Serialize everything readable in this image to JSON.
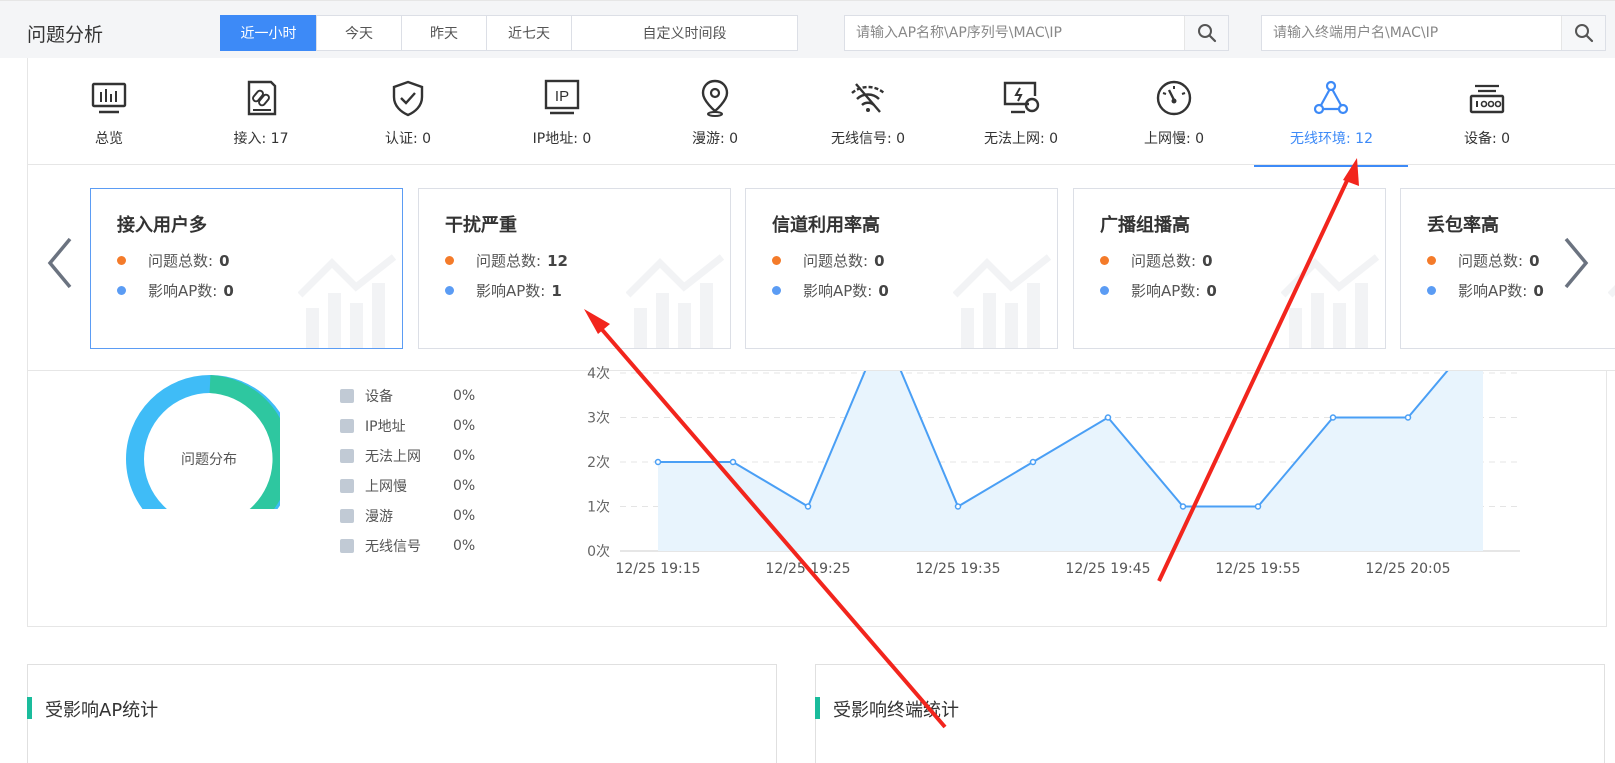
{
  "header": {
    "title": "问题分析",
    "time_tabs": [
      "近一小时",
      "今天",
      "昨天",
      "近七天",
      "自定义时间段"
    ],
    "active_tab": 0,
    "ap_search_placeholder": "请输入AP名称\\AP序列号\\MAC\\IP",
    "user_search_placeholder": "请输入终端用户名\\MAC\\IP"
  },
  "categories": [
    {
      "label": "总览",
      "icon": "monitor-chart-icon"
    },
    {
      "label": "接入: 17",
      "icon": "access-link-icon"
    },
    {
      "label": "认证: 0",
      "icon": "shield-check-icon"
    },
    {
      "label": "IP地址: 0",
      "icon": "ip-icon"
    },
    {
      "label": "漫游: 0",
      "icon": "location-pin-icon"
    },
    {
      "label": "无线信号: 0",
      "icon": "wifi-off-icon"
    },
    {
      "label": "无法上网: 0",
      "icon": "monitor-offline-icon"
    },
    {
      "label": "上网慢: 0",
      "icon": "speedometer-icon"
    },
    {
      "label": "无线环境: 12",
      "icon": "topology-icon",
      "active": true
    },
    {
      "label": "设备: 0",
      "icon": "router-device-icon"
    }
  ],
  "issue_cards": [
    {
      "title": "接入用户多",
      "total_label": "问题总数:",
      "total": "0",
      "ap_label": "影响AP数:",
      "ap": "0"
    },
    {
      "title": "干扰严重",
      "total_label": "问题总数:",
      "total": "12",
      "ap_label": "影响AP数:",
      "ap": "1"
    },
    {
      "title": "信道利用率高",
      "total_label": "问题总数:",
      "total": "0",
      "ap_label": "影响AP数:",
      "ap": "0"
    },
    {
      "title": "广播组播高",
      "total_label": "问题总数:",
      "total": "0",
      "ap_label": "影响AP数:",
      "ap": "0"
    },
    {
      "title": "丢包率高",
      "total_label": "问题总数:",
      "total": "0",
      "ap_label": "影响AP数:",
      "ap": "0"
    }
  ],
  "distribution": {
    "center_label": "问题分布",
    "colors": {
      "teal": "#2ec7a0",
      "blue": "#3fbcf7"
    },
    "legend": [
      {
        "name": "设备",
        "pct": "0%"
      },
      {
        "name": "IP地址",
        "pct": "0%"
      },
      {
        "name": "无法上网",
        "pct": "0%"
      },
      {
        "name": "上网慢",
        "pct": "0%"
      },
      {
        "name": "漫游",
        "pct": "0%"
      },
      {
        "name": "无线信号",
        "pct": "0%"
      }
    ]
  },
  "chart_data": {
    "type": "area",
    "x": [
      "19:15",
      "19:20",
      "19:25",
      "19:30",
      "19:35",
      "19:40",
      "19:45",
      "19:50",
      "19:55",
      "20:00",
      "20:05",
      "20:10"
    ],
    "x_tick_labels": [
      "12/25 19:15",
      "12/25 19:25",
      "12/25 19:35",
      "12/25 19:45",
      "12/25 19:55",
      "12/25 20:05"
    ],
    "y_tick_labels": [
      "0次",
      "1次",
      "2次",
      "3次",
      "4次"
    ],
    "series": [
      {
        "values": [
          2,
          2,
          1,
          5,
          1,
          2,
          3,
          1,
          1,
          3,
          3,
          5
        ]
      }
    ],
    "ylim": [
      0,
      4
    ],
    "grid": true,
    "line_color": "#4a9ff5",
    "fill_color": "#e8f4fd"
  },
  "panels": {
    "ap_stats_title": "受影响AP统计",
    "terminal_stats_title": "受影响终端统计"
  }
}
